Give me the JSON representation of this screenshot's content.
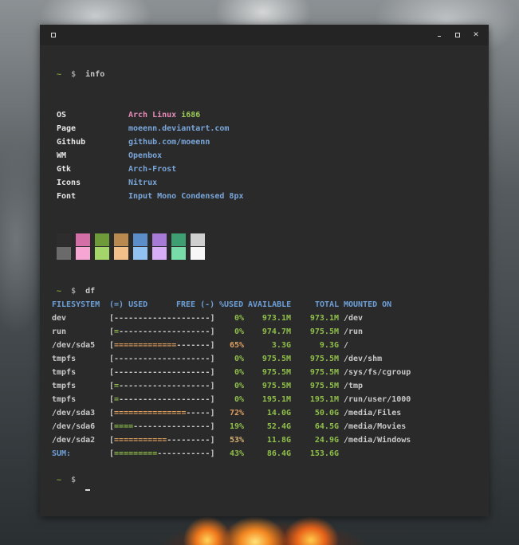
{
  "window": {
    "title_icons": [
      "window-menu-icon",
      "minimize-icon",
      "maximize-icon",
      "close-icon"
    ]
  },
  "prompt": {
    "tilde": "~",
    "dollar": "$"
  },
  "commands": {
    "info": "info",
    "df": "df"
  },
  "info": [
    {
      "label": "OS",
      "value": "Arch Linux ",
      "value_extra": "i686"
    },
    {
      "label": "Page",
      "value": "moeenn.deviantart.com"
    },
    {
      "label": "Github",
      "value": "github.com/moeenn"
    },
    {
      "label": "WM",
      "value": "Openbox"
    },
    {
      "label": "Gtk",
      "value": "Arch-Frost"
    },
    {
      "label": "Icons",
      "value": "Nitrux"
    },
    {
      "label": "Font",
      "value": "Input Mono Condensed 8px"
    }
  ],
  "palette": {
    "top": [
      "#2d2d2d",
      "#d46ea6",
      "#6f9a3a",
      "#b9894f",
      "#5b8ec8",
      "#a87ad8",
      "#3e9f72",
      "#cfcfcf"
    ],
    "bottom": [
      "#6a6a6a",
      "#f7a6d4",
      "#a4d46a",
      "#f3c08a",
      "#92c2f2",
      "#d8aef8",
      "#78dca8",
      "#f7f7f7"
    ]
  },
  "df": {
    "headers": [
      "FILESYSTEM",
      "(=) USED",
      "FREE (-)",
      "%USED",
      "AVAILABLE",
      "TOTAL",
      "MOUNTED ON"
    ],
    "rows": [
      {
        "fs": "dev",
        "bar_fill": "",
        "bar_rest": "--------------------",
        "pct": "0%",
        "avail": "973.1M",
        "total": "973.1M",
        "mount": "/dev",
        "level": "low"
      },
      {
        "fs": "run",
        "bar_fill": "=",
        "bar_rest": "-------------------",
        "pct": "0%",
        "avail": "974.7M",
        "total": "975.5M",
        "mount": "/run",
        "level": "low"
      },
      {
        "fs": "/dev/sda5",
        "bar_fill": "=============",
        "bar_rest": "-------",
        "pct": "65%",
        "avail": "3.3G",
        "total": "9.3G",
        "mount": "/",
        "level": "high"
      },
      {
        "fs": "tmpfs",
        "bar_fill": "",
        "bar_rest": "--------------------",
        "pct": "0%",
        "avail": "975.5M",
        "total": "975.5M",
        "mount": "/dev/shm",
        "level": "low"
      },
      {
        "fs": "tmpfs",
        "bar_fill": "",
        "bar_rest": "--------------------",
        "pct": "0%",
        "avail": "975.5M",
        "total": "975.5M",
        "mount": "/sys/fs/cgroup",
        "level": "low"
      },
      {
        "fs": "tmpfs",
        "bar_fill": "=",
        "bar_rest": "-------------------",
        "pct": "0%",
        "avail": "975.5M",
        "total": "975.5M",
        "mount": "/tmp",
        "level": "low"
      },
      {
        "fs": "tmpfs",
        "bar_fill": "=",
        "bar_rest": "-------------------",
        "pct": "0%",
        "avail": "195.1M",
        "total": "195.1M",
        "mount": "/run/user/1000",
        "level": "low"
      },
      {
        "fs": "/dev/sda3",
        "bar_fill": "===============",
        "bar_rest": "-----",
        "pct": "72%",
        "avail": "14.0G",
        "total": "50.0G",
        "mount": "/media/Files",
        "level": "high"
      },
      {
        "fs": "/dev/sda6",
        "bar_fill": "====",
        "bar_rest": "----------------",
        "pct": "19%",
        "avail": "52.4G",
        "total": "64.5G",
        "mount": "/media/Movies",
        "level": "low"
      },
      {
        "fs": "/dev/sda2",
        "bar_fill": "===========",
        "bar_rest": "---------",
        "pct": "53%",
        "avail": "11.8G",
        "total": "24.9G",
        "mount": "/media/Windows",
        "level": "mid"
      }
    ],
    "sum": {
      "fs": "SUM:",
      "bar_fill": "=========",
      "bar_rest": "-----------",
      "pct": "43%",
      "avail": "86.4G",
      "total": "153.6G"
    }
  }
}
